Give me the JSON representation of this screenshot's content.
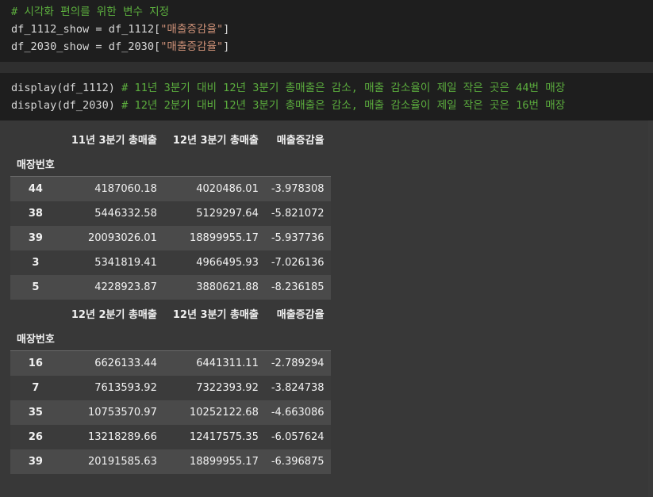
{
  "cell1": {
    "line1_comment": "# 시각화 편의를 위한 변수 지정",
    "line2_code": "df_1112_show = df_1112[",
    "line2_str": "\"매출증감율\"",
    "line2_end": "]",
    "line3_code": "df_2030_show = df_2030[",
    "line3_str": "\"매출증감율\"",
    "line3_end": "]"
  },
  "cell2": {
    "line1_code": "display(df_1112) ",
    "line1_comment": "# 11년 3분기 대비 12년 3분기 총매출은 감소, 매출 감소율이 제일 작은 곳은 44번 매장",
    "line2_code": "display(df_2030) ",
    "line2_comment": "# 12년 2분기 대비 12년 3분기 총매출은 감소, 매출 감소율이 제일 작은 곳은 16번 매장"
  },
  "table1": {
    "columns": [
      "11년 3분기 총매출",
      "12년 3분기 총매출",
      "매출증감율"
    ],
    "index_name": "매장번호",
    "rows": [
      {
        "idx": "44",
        "a": "4187060.18",
        "b": "4020486.01",
        "c": "-3.978308"
      },
      {
        "idx": "38",
        "a": "5446332.58",
        "b": "5129297.64",
        "c": "-5.821072"
      },
      {
        "idx": "39",
        "a": "20093026.01",
        "b": "18899955.17",
        "c": "-5.937736"
      },
      {
        "idx": "3",
        "a": "5341819.41",
        "b": "4966495.93",
        "c": "-7.026136"
      },
      {
        "idx": "5",
        "a": "4228923.87",
        "b": "3880621.88",
        "c": "-8.236185"
      }
    ]
  },
  "table2": {
    "columns": [
      "12년 2분기 총매출",
      "12년 3분기 총매출",
      "매출증감율"
    ],
    "index_name": "매장번호",
    "rows": [
      {
        "idx": "16",
        "a": "6626133.44",
        "b": "6441311.11",
        "c": "-2.789294"
      },
      {
        "idx": "7",
        "a": "7613593.92",
        "b": "7322393.92",
        "c": "-3.824738"
      },
      {
        "idx": "35",
        "a": "10753570.97",
        "b": "10252122.68",
        "c": "-4.663086"
      },
      {
        "idx": "26",
        "a": "13218289.66",
        "b": "12417575.35",
        "c": "-6.057624"
      },
      {
        "idx": "39",
        "a": "20191585.63",
        "b": "18899955.17",
        "c": "-6.396875"
      }
    ]
  }
}
